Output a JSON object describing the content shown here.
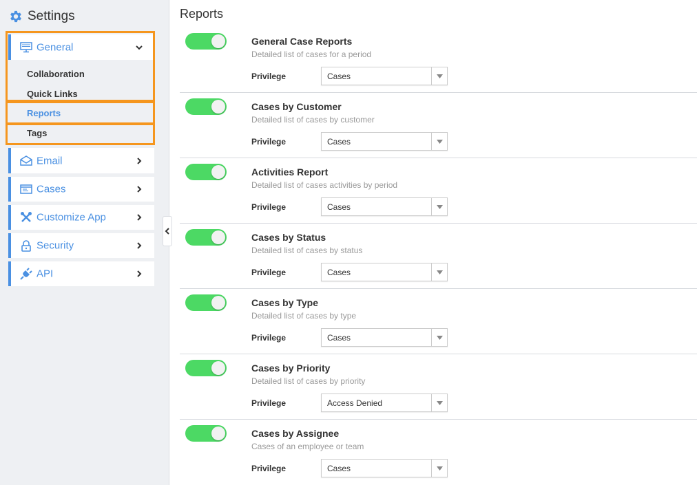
{
  "sidebar": {
    "title": "Settings",
    "groups": [
      {
        "label": "General",
        "icon": "monitor-icon"
      },
      {
        "label": "Email",
        "icon": "envelope-icon"
      },
      {
        "label": "Cases",
        "icon": "cases-window-icon"
      },
      {
        "label": "Customize App",
        "icon": "tools-icon"
      },
      {
        "label": "Security",
        "icon": "lock-icon"
      },
      {
        "label": "API",
        "icon": "plug-icon"
      }
    ],
    "general_subitems": [
      "Collaboration",
      "Quick Links",
      "Reports",
      "Tags"
    ],
    "active_subitem": "Reports"
  },
  "main": {
    "title": "Reports",
    "privilege_label": "Privilege",
    "reports": [
      {
        "title": "General Case Reports",
        "description": "Detailed list of cases for a period",
        "enabled": true,
        "privilege": "Cases"
      },
      {
        "title": "Cases by Customer",
        "description": "Detailed list of cases by customer",
        "enabled": true,
        "privilege": "Cases"
      },
      {
        "title": "Activities Report",
        "description": "Detailed list of cases activities by period",
        "enabled": true,
        "privilege": "Cases"
      },
      {
        "title": "Cases by Status",
        "description": "Detailed list of cases by status",
        "enabled": true,
        "privilege": "Cases"
      },
      {
        "title": "Cases by Type",
        "description": "Detailed list of cases by type",
        "enabled": true,
        "privilege": "Cases"
      },
      {
        "title": "Cases by Priority",
        "description": "Detailed list of cases by priority",
        "enabled": true,
        "privilege": "Access Denied"
      },
      {
        "title": "Cases by Assignee",
        "description": "Cases of an employee or team",
        "enabled": true,
        "privilege": "Cases"
      }
    ]
  },
  "colors": {
    "accent": "#4a90e2",
    "toggle_on": "#4cd964",
    "highlight": "#f5961e"
  }
}
